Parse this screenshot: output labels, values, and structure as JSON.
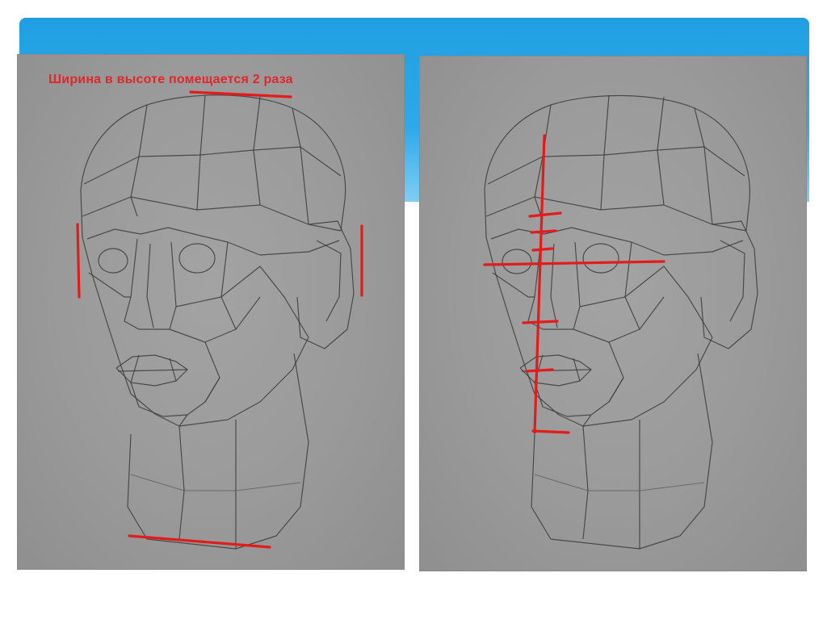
{
  "left_photo": {
    "caption": "Ширина в высоте помещается 2 раза"
  },
  "colors": {
    "header_blue": "#1f9fe2",
    "paper_gray": "#9a9a9a",
    "pencil": "#3c3c3c",
    "marker_red": "#e31b1b"
  }
}
